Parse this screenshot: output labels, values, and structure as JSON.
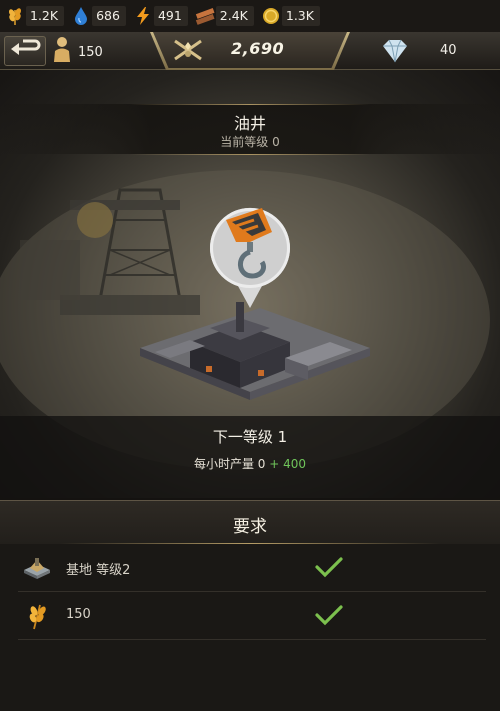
{
  "resources": [
    {
      "icon": "wheat-icon",
      "value": "1.2K"
    },
    {
      "icon": "oil-drop-icon",
      "value": "686"
    },
    {
      "icon": "lightning-icon",
      "value": "491"
    },
    {
      "icon": "steel-icon",
      "value": "2.4K"
    },
    {
      "icon": "gold-coin-icon",
      "value": "1.3K"
    }
  ],
  "topbar": {
    "population": "150",
    "power": "2,690",
    "diamonds": "40"
  },
  "building": {
    "name": "油井",
    "current_level": "当前等级 0"
  },
  "upgrade": {
    "next_level": "下一等级 1",
    "production_label": "每小时产量",
    "production_current": "0",
    "production_increase": "+ 400"
  },
  "requirements": {
    "title": "要求",
    "items": [
      {
        "icon": "base-building-icon",
        "label": "基地 等级2",
        "met": true
      },
      {
        "icon": "wheat-icon",
        "label": "150",
        "met": true
      }
    ]
  },
  "colors": {
    "accent_gold": "#b59c66",
    "increase_green": "#6fc45a",
    "check_green": "#7cc04e"
  }
}
